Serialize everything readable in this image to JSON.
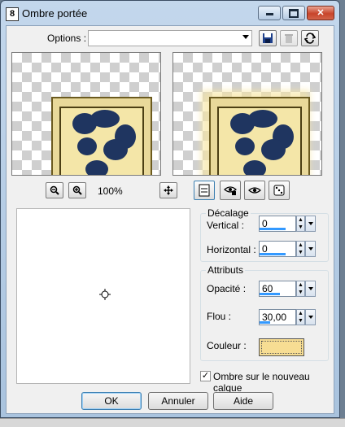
{
  "window": {
    "app_icon": "8",
    "title": "Ombre portée"
  },
  "titlebar_buttons": {
    "minimize_icon": "minimize-icon",
    "maximize_icon": "maximize-icon",
    "close_icon": "close-icon"
  },
  "options": {
    "label": "Options :",
    "value": ""
  },
  "zoom": {
    "level": "100%"
  },
  "offset_group": {
    "title": "Décalage",
    "vertical_label": "Vertical :",
    "vertical_value": "0",
    "vertical_fraction": 0.75,
    "horizontal_label": "Horizontal :",
    "horizontal_value": "0",
    "horizontal_fraction": 0.75
  },
  "attributes_group": {
    "title": "Attributs",
    "opacity_label": "Opacité :",
    "opacity_value": "60",
    "opacity_fraction": 0.6,
    "blur_label": "Flou :",
    "blur_value": "30,00",
    "blur_fraction": 0.3,
    "color_label": "Couleur :",
    "color_value": "#f7dd93"
  },
  "checkbox": {
    "label": "Ombre sur le nouveau calque",
    "checked": true
  },
  "buttons": {
    "ok": "OK",
    "cancel": "Annuler",
    "help": "Aide"
  }
}
